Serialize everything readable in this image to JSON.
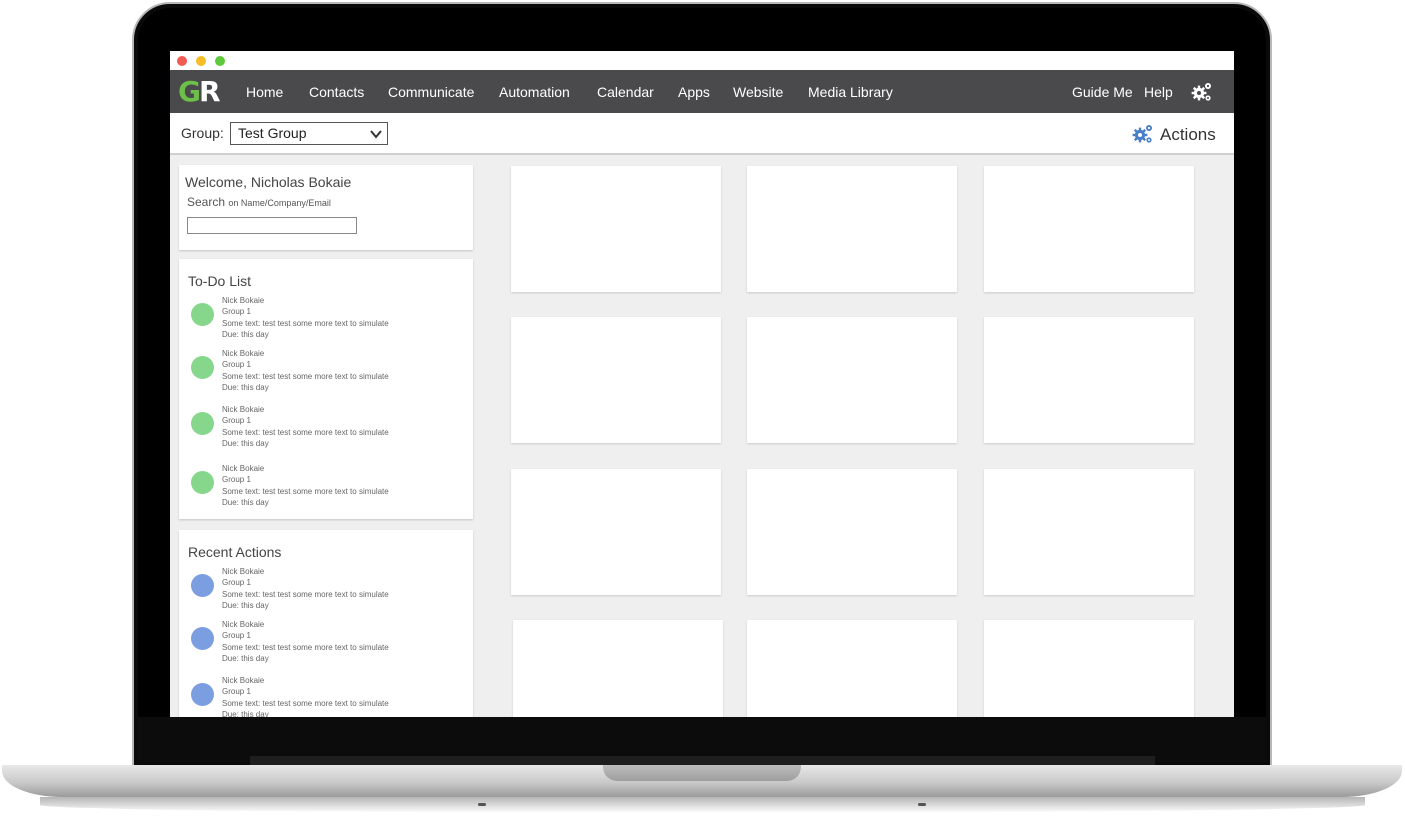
{
  "colors": {
    "nav_bg": "#4a494c",
    "logo_green": "#6cc04a",
    "todo_dot": "#86d68b",
    "recent_dot": "#7a9edf",
    "gear_blue": "#4a7fc8",
    "traffic_red": "#f25a54",
    "traffic_yellow": "#f5bd26",
    "traffic_green": "#5dc93b"
  },
  "nav": {
    "logo_g": "G",
    "logo_r": "R",
    "items": [
      "Home",
      "Contacts",
      "Communicate",
      "Automation",
      "Calendar",
      "Apps",
      "Website",
      "Media Library"
    ],
    "right_items": [
      "Guide Me",
      "Help"
    ],
    "settings_icon": "gear-icon"
  },
  "toolbar": {
    "group_label": "Group:",
    "group_selected": "Test Group",
    "actions_label": "Actions",
    "actions_icon": "gears-icon"
  },
  "welcome": {
    "title": "Welcome, Nicholas Bokaie",
    "search_label": "Search",
    "search_hint": "on Name/Company/Email",
    "search_value": ""
  },
  "todo": {
    "title": "To-Do List",
    "items": [
      {
        "name": "Nick Bokaie",
        "group": "Group 1",
        "text": "Some text: test test some more text to simulate",
        "due": "Due: this day"
      },
      {
        "name": "Nick Bokaie",
        "group": "Group 1",
        "text": "Some text: test test some more text to simulate",
        "due": "Due: this day"
      },
      {
        "name": "Nick Bokaie",
        "group": "Group 1",
        "text": "Some text: test test some more text to simulate",
        "due": "Due: this day"
      },
      {
        "name": "Nick Bokaie",
        "group": "Group 1",
        "text": "Some text: test test some more text to simulate",
        "due": "Due: this day"
      }
    ]
  },
  "recent": {
    "title": "Recent Actions",
    "items": [
      {
        "name": "Nick Bokaie",
        "group": "Group 1",
        "text": "Some text: test test some more text to simulate",
        "due": "Due: this day"
      },
      {
        "name": "Nick Bokaie",
        "group": "Group 1",
        "text": "Some text: test test some more text to simulate",
        "due": "Due: this day"
      },
      {
        "name": "Nick Bokaie",
        "group": "Group 1",
        "text": "Some text: test test some more text to simulate",
        "due": "Due: this day"
      }
    ]
  }
}
